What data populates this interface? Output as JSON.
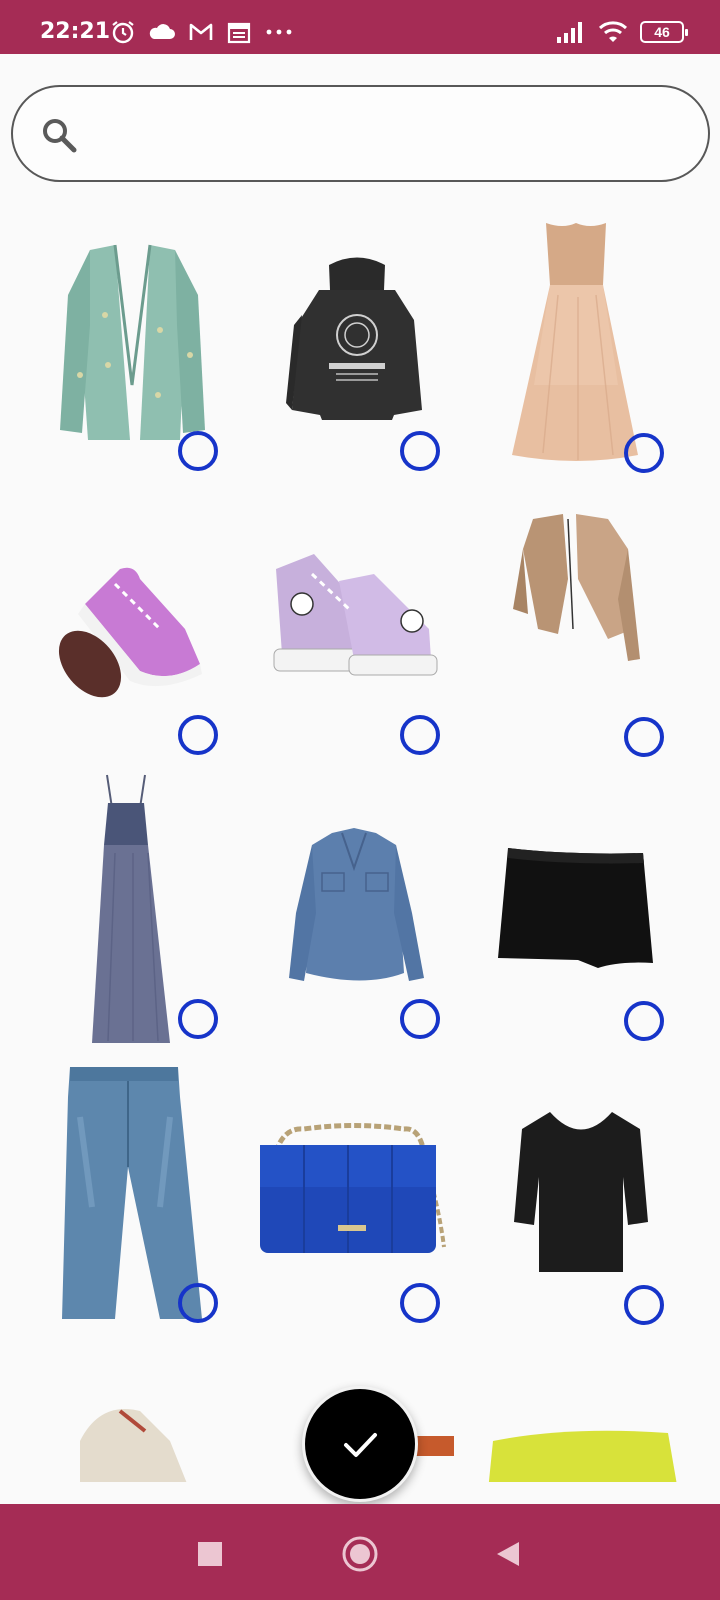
{
  "status_bar": {
    "time": "22:21",
    "battery": "46",
    "background": "#a52c55",
    "left_icons": [
      "alarm-icon",
      "cloud-icon",
      "gmail-icon",
      "calendar-icon",
      "more-dots-icon"
    ],
    "right_icons": [
      "signal-icon",
      "wifi-icon",
      "battery-icon"
    ]
  },
  "search": {
    "placeholder": "",
    "value": ""
  },
  "accent_color": "#1634c9",
  "items": [
    {
      "name": "green-cardigan-image",
      "selected": false
    },
    {
      "name": "black-hoodie-image",
      "selected": false
    },
    {
      "name": "peach-tulle-dress-image",
      "selected": false
    },
    {
      "name": "pink-sneaker-image",
      "selected": false
    },
    {
      "name": "lilac-platform-sneakers-image",
      "selected": false
    },
    {
      "name": "beige-cardigan-image",
      "selected": false
    },
    {
      "name": "navy-maxi-dress-image",
      "selected": false
    },
    {
      "name": "blue-blouse-image",
      "selected": false
    },
    {
      "name": "black-mini-skirt-image",
      "selected": false
    },
    {
      "name": "blue-jeans-image",
      "selected": false
    },
    {
      "name": "blue-chain-bag-image",
      "selected": false
    },
    {
      "name": "black-top-image",
      "selected": false
    },
    {
      "name": "beige-sneaker-image",
      "selected": false
    },
    {
      "name": "orange-item-image",
      "selected": false
    },
    {
      "name": "yellow-item-image",
      "selected": false
    }
  ],
  "fab": {
    "icon": "check-icon"
  },
  "nav_bar": {
    "icons": [
      "recents-square-icon",
      "home-circle-icon",
      "back-triangle-icon"
    ]
  }
}
